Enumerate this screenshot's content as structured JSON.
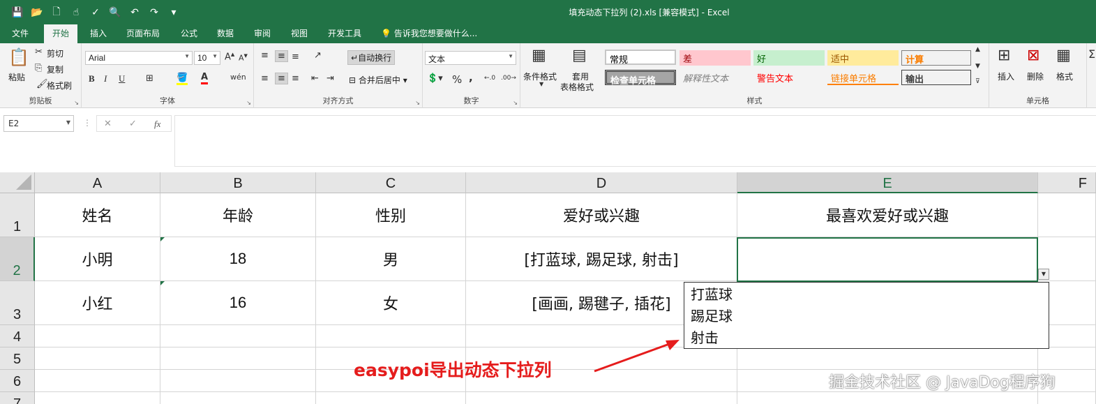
{
  "title_bar": {
    "doc_title": "填充动态下拉列 (2).xls  [兼容模式] - Excel"
  },
  "tabs": [
    "文件",
    "开始",
    "插入",
    "页面布局",
    "公式",
    "数据",
    "审阅",
    "视图",
    "开发工具"
  ],
  "active_tab": "开始",
  "tell_me": "告诉我您想要做什么...",
  "ribbon": {
    "clipboard": {
      "paste": "粘贴",
      "cut": "剪切",
      "copy": "复制",
      "format_painter": "格式刷",
      "label": "剪贴板"
    },
    "font": {
      "name": "Arial",
      "size": "10",
      "bold": "B",
      "italic": "I",
      "underline": "U",
      "label": "字体"
    },
    "alignment": {
      "wrap_text": "自动换行",
      "merge_center": "合并后居中",
      "label": "对齐方式"
    },
    "number": {
      "format": "文本",
      "percent": "%",
      "comma": ",",
      "label": "数字"
    },
    "styles": {
      "conditional": "条件格式",
      "table_format_1": "套用",
      "table_format_2": "表格格式",
      "cells": [
        "常规",
        "差",
        "好",
        "适中",
        "计算",
        "检查单元格",
        "解释性文本",
        "警告文本",
        "链接单元格",
        "输出"
      ],
      "label": "样式"
    },
    "cells_group": {
      "insert": "插入",
      "delete": "删除",
      "format": "格式",
      "label": "单元格"
    }
  },
  "formula_bar": {
    "name_box": "E2",
    "fx": "fx",
    "formula": ""
  },
  "columns": [
    "A",
    "B",
    "C",
    "D",
    "E",
    "F"
  ],
  "rows": [
    "1",
    "2",
    "3",
    "4",
    "5",
    "6",
    "7"
  ],
  "sheet": {
    "header": [
      "姓名",
      "年龄",
      "性别",
      "爱好或兴趣",
      "最喜欢爱好或兴趣"
    ],
    "data": [
      [
        "小明",
        "18",
        "男",
        "[打蓝球, 踢足球, 射击]",
        ""
      ],
      [
        "小红",
        "16",
        "女",
        "[画画, 踢毽子, 插花]",
        ""
      ]
    ]
  },
  "dropdown": {
    "options": [
      "打蓝球",
      "踢足球",
      "射击"
    ]
  },
  "annotation": "easypoi导出动态下拉列",
  "watermark": "掘金技术社区 @ JavaDog程序狗",
  "colors": {
    "accent": "#217346",
    "annotation": "#e51c1c"
  }
}
